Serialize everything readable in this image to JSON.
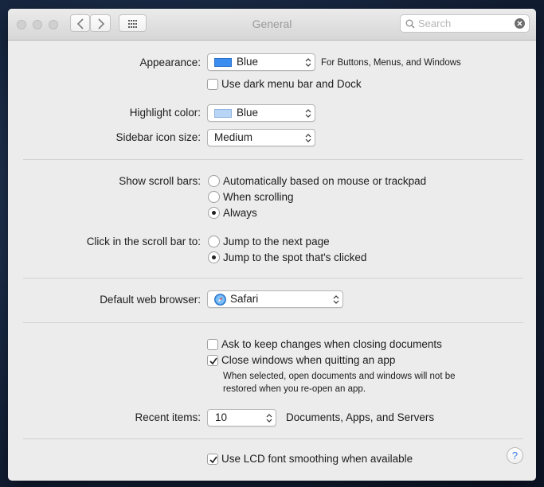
{
  "window": {
    "title": "General"
  },
  "search": {
    "placeholder": "Search",
    "value": ""
  },
  "appearance": {
    "label": "Appearance:",
    "value": "Blue",
    "swatch_color": "#3b8ef0",
    "note": "For Buttons, Menus, and Windows",
    "dark_menu_label": "Use dark menu bar and Dock",
    "dark_menu_checked": false
  },
  "highlight": {
    "label": "Highlight color:",
    "value": "Blue",
    "swatch_color": "#b8d5f5"
  },
  "sidebar_icon_size": {
    "label": "Sidebar icon size:",
    "value": "Medium"
  },
  "scroll_bars": {
    "label": "Show scroll bars:",
    "options": [
      {
        "label": "Automatically based on mouse or trackpad",
        "selected": false
      },
      {
        "label": "When scrolling",
        "selected": false
      },
      {
        "label": "Always",
        "selected": true
      }
    ]
  },
  "click_scroll": {
    "label": "Click in the scroll bar to:",
    "options": [
      {
        "label": "Jump to the next page",
        "selected": false
      },
      {
        "label": "Jump to the spot that's clicked",
        "selected": true
      }
    ]
  },
  "browser": {
    "label": "Default web browser:",
    "value": "Safari",
    "icon": "safari-icon"
  },
  "documents": {
    "ask_keep_label": "Ask to keep changes when closing documents",
    "ask_keep_checked": false,
    "close_windows_label": "Close windows when quitting an app",
    "close_windows_checked": true,
    "close_windows_note_1": "When selected, open documents and windows will not be",
    "close_windows_note_2": "restored when you re-open an app."
  },
  "recent_items": {
    "label": "Recent items:",
    "value": "10",
    "note": "Documents, Apps, and Servers"
  },
  "lcd": {
    "label": "Use LCD font smoothing when available",
    "checked": true
  },
  "help": {
    "glyph": "?"
  },
  "colors": {
    "accent": "#3b7ee6"
  }
}
